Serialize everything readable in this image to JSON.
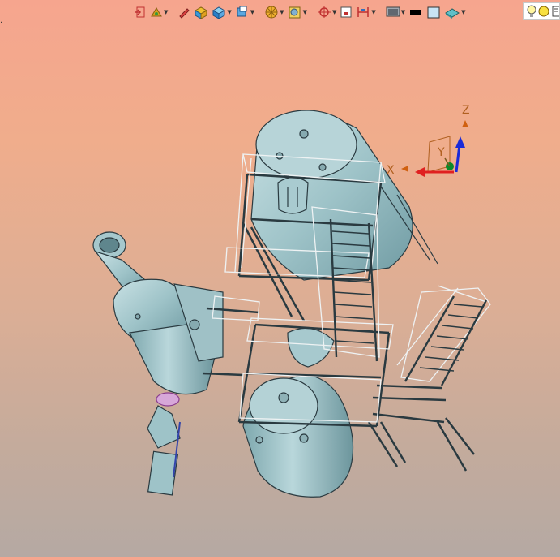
{
  "viewport": {
    "corner_mark": ".",
    "axis_labels": {
      "x": "X",
      "y": "Y",
      "z": "Z"
    }
  },
  "toolbar": {
    "buttons": [
      {
        "name": "exit-sketch-button",
        "icon": "exit-icon"
      },
      {
        "name": "fly-mode-button",
        "icon": "fly-mode-icon"
      },
      {
        "name": "sketch-pen-button",
        "icon": "pen-icon"
      },
      {
        "name": "normal-view-button",
        "icon": "normal-view-icon"
      },
      {
        "name": "isometric-view-button",
        "icon": "isometric-view-icon"
      },
      {
        "name": "views-dropdown-button",
        "icon": "views-icon"
      },
      {
        "name": "view-mode-button",
        "icon": "view-mode-icon"
      },
      {
        "name": "section-view-button",
        "icon": "section-view-icon"
      },
      {
        "name": "hide-show-button",
        "icon": "hide-show-icon"
      },
      {
        "name": "measure-button",
        "icon": "measure-icon"
      },
      {
        "name": "dimension-button",
        "icon": "dimension-icon"
      },
      {
        "name": "display-settings-button",
        "icon": "display-icon"
      },
      {
        "name": "black-color-button",
        "icon": "black-swatch-icon"
      },
      {
        "name": "background-button",
        "icon": "background-icon"
      },
      {
        "name": "material-button",
        "icon": "material-icon"
      },
      {
        "name": "light-button",
        "icon": "light-bulb-icon"
      },
      {
        "name": "sun-button",
        "icon": "sun-icon"
      }
    ]
  },
  "colors": {
    "model_fill": "#9ec3c8",
    "model_stroke": "#2a3a40",
    "rail": "#e8ecee",
    "axis_x": "#e02020",
    "axis_z": "#1a2ad8",
    "axis_y": "#0a8a2a",
    "triad_label": "#b06020"
  }
}
